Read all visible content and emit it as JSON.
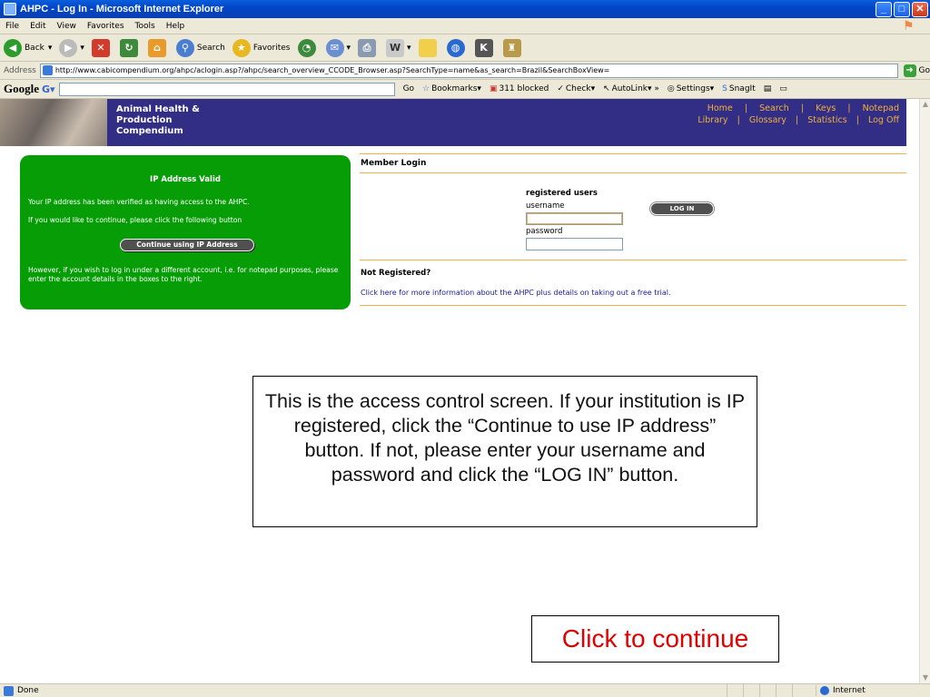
{
  "window": {
    "title": "AHPC - Log In - Microsoft Internet Explorer"
  },
  "menu": [
    "File",
    "Edit",
    "View",
    "Favorites",
    "Tools",
    "Help"
  ],
  "toolbar": {
    "back": "Back",
    "search": "Search",
    "favorites": "Favorites"
  },
  "address": {
    "label": "Address",
    "url": "http://www.cabicompendium.org/ahpc/aclogin.asp?/ahpc/search_overview_CCODE_Browser.asp?SearchType=name&as_search=Brazil&SearchBoxView=",
    "go": "Go"
  },
  "googlebar": {
    "logo": "Google",
    "go": "Go",
    "bookmarks": "Bookmarks",
    "blocked": "311 blocked",
    "check": "Check",
    "autolink": "AutoLink",
    "settings": "Settings",
    "snagit": "SnagIt"
  },
  "site": {
    "brand": [
      "Animal Health &",
      "Production",
      "Compendium"
    ],
    "nav_row1": [
      "Home",
      "Search",
      "Keys",
      "Notepad"
    ],
    "nav_row2": [
      "Library",
      "Glossary",
      "Statistics",
      "Log Off"
    ]
  },
  "ip_box": {
    "title": "IP Address Valid",
    "p1": "Your IP address has been verified as having access to the AHPC.",
    "p2": "If you would like to continue, please click the following button",
    "button": "Continue using IP Address",
    "p3": "However, if you wish to log in under a different account, i.e. for notepad purposes, please enter the account details in the boxes to the right."
  },
  "login": {
    "heading": "Member Login",
    "registered": "registered users",
    "username_label": "username",
    "password_label": "password",
    "button": "LOG IN",
    "username_value": "",
    "password_value": ""
  },
  "not_registered": {
    "title": "Not Registered?",
    "link": "Click here for more information about the AHPC plus details on taking out a free trial."
  },
  "callout": "This is the access control screen.  If your institution is IP registered, click the “Continue to use IP address” button.  If not, please enter your username and password and click the “LOG IN” button.",
  "continue": "Click to continue",
  "status": {
    "text": "Done",
    "zone": "Internet"
  }
}
